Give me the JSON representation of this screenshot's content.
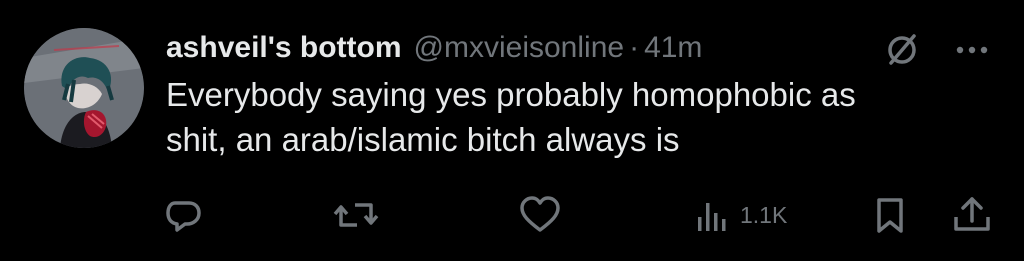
{
  "tweet": {
    "display_name": "ashveil's bottom",
    "handle": "@mxvieisonline",
    "separator": "·",
    "time": "41m",
    "text_lines": [
      "Everybody saying yes probably homophobic as",
      "shit, an arab/islamic bitch always is"
    ]
  },
  "actions": {
    "views_count": "1.1K"
  },
  "icons": {
    "header": [
      "grok-icon",
      "more-options-icon"
    ],
    "actions": [
      "reply-icon",
      "repost-icon",
      "like-icon",
      "views-icon",
      "bookmark-icon",
      "share-icon"
    ]
  },
  "colors": {
    "background": "#000000",
    "primary_text": "#e7e9ea",
    "secondary_text": "#71767b"
  }
}
